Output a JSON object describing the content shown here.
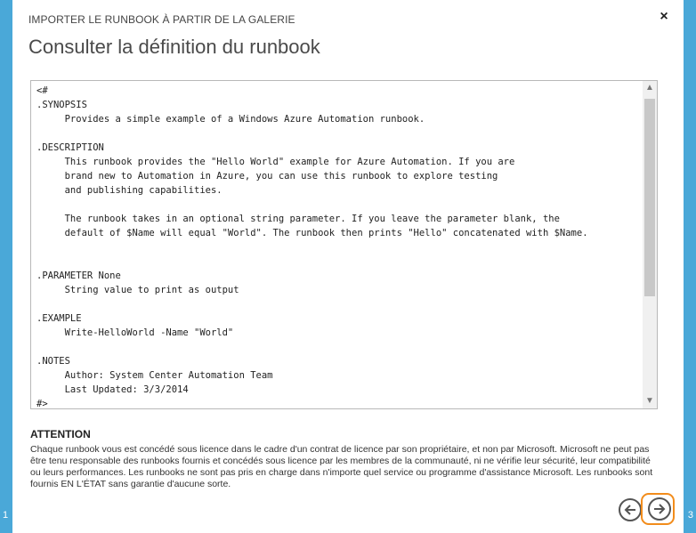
{
  "dialog": {
    "header": "IMPORTER LE RUNBOOK À PARTIR DE LA GALERIE",
    "title": "Consulter la définition du runbook",
    "close_icon": "×"
  },
  "code": {
    "text": "<#\n.SYNOPSIS\n     Provides a simple example of a Windows Azure Automation runbook.\n\n.DESCRIPTION\n     This runbook provides the \"Hello World\" example for Azure Automation. If you are\n     brand new to Automation in Azure, you can use this runbook to explore testing\n     and publishing capabilities.\n\n     The runbook takes in an optional string parameter. If you leave the parameter blank, the\n     default of $Name will equal \"World\". The runbook then prints \"Hello\" concatenated with $Name.\n\n\n.PARAMETER None\n     String value to print as output\n\n.EXAMPLE\n     Write-HelloWorld -Name \"World\"\n\n.NOTES\n     Author: System Center Automation Team\n     Last Updated: 3/3/2014\n#>"
  },
  "attention": {
    "title": "ATTENTION",
    "body": "Chaque runbook vous est concédé sous licence dans le cadre d'un contrat de licence par son propriétaire, et non par Microsoft. Microsoft ne peut pas être tenu responsable des runbooks fournis et concédés sous licence par les membres de la communauté, ni ne vérifie leur sécurité, leur compatibilité ou leurs performances. Les runbooks ne sont pas pris en charge dans n'importe quel service ou programme d'assistance Microsoft. Les runbooks sont fournis EN L'ÉTAT sans garantie d'aucune sorte."
  },
  "pager": {
    "left": "1",
    "right": "3"
  },
  "nav": {
    "prev_icon": "arrow-left-circle-icon",
    "next_icon": "arrow-right-circle-icon",
    "highlight_color": "#f28c1b"
  },
  "theme": {
    "side_color": "#4aa8d8"
  }
}
